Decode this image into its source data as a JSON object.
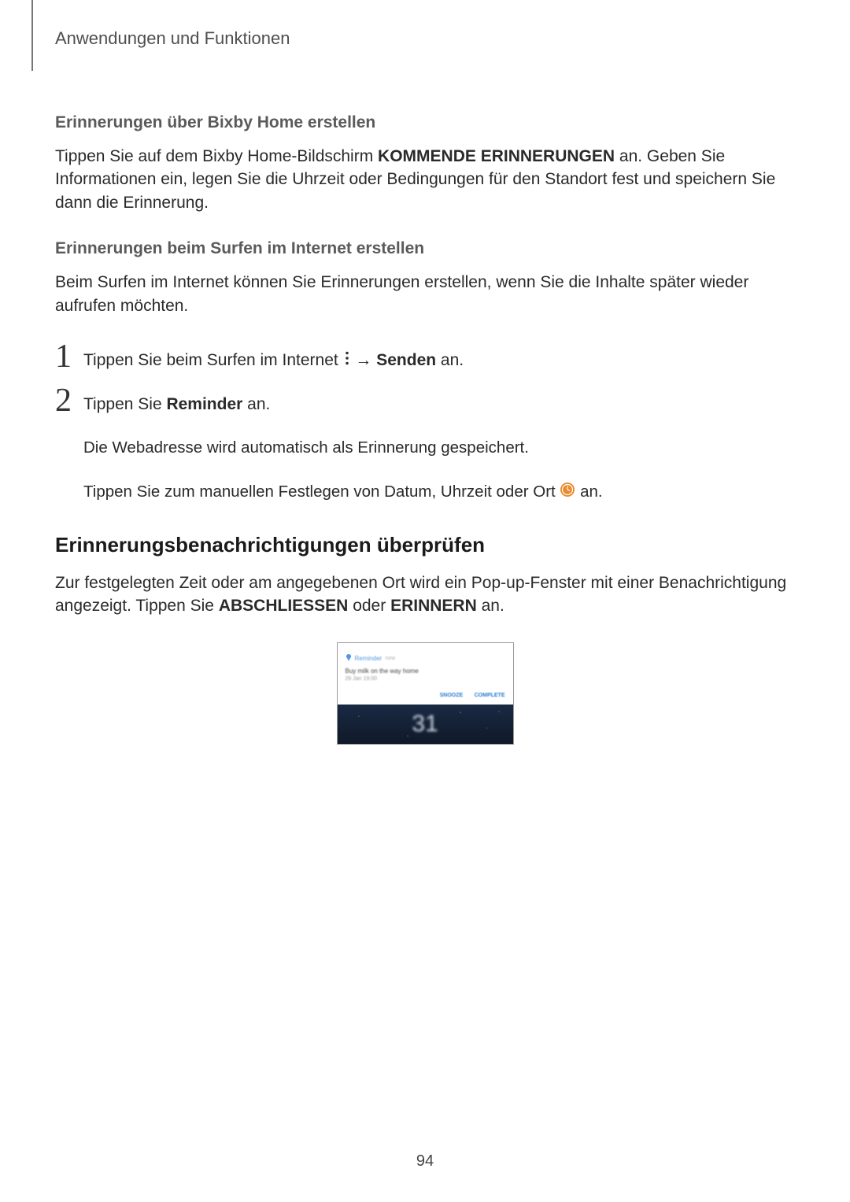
{
  "header": {
    "section": "Anwendungen und Funktionen"
  },
  "s1": {
    "title": "Erinnerungen über Bixby Home erstellen",
    "p_pre": "Tippen Sie auf dem Bixby Home-Bildschirm ",
    "p_bold": "KOMMENDE ERINNERUNGEN",
    "p_post": " an. Geben Sie Informationen ein, legen Sie die Uhrzeit oder Bedingungen für den Standort fest und speichern Sie dann die Erinnerung."
  },
  "s2": {
    "title": "Erinnerungen beim Surfen im Internet erstellen",
    "p": "Beim Surfen im Internet können Sie Erinnerungen erstellen, wenn Sie die Inhalte später wieder aufrufen möchten."
  },
  "step1": {
    "num": "1",
    "pre": "Tippen Sie beim Surfen im Internet ",
    "arrow": " → ",
    "bold": "Senden",
    "post": " an."
  },
  "step2": {
    "num": "2",
    "pre": "Tippen Sie ",
    "bold": "Reminder",
    "post": " an.",
    "sub1": "Die Webadresse wird automatisch als Erinnerung gespeichert.",
    "sub2_pre": "Tippen Sie zum manuellen Festlegen von Datum, Uhrzeit oder Ort ",
    "sub2_post": " an."
  },
  "s3": {
    "title": "Erinnerungsbenachrichtigungen überprüfen",
    "p_pre": "Zur festgelegten Zeit oder am angegebenen Ort wird ein Pop-up-Fenster mit einer Benachrichtigung angezeigt. Tippen Sie ",
    "p_b1": "ABSCHLIESSEN",
    "p_mid": " oder ",
    "p_b2": "ERINNERN",
    "p_post": " an."
  },
  "screenshot": {
    "app": "Reminder",
    "time": "now",
    "title": "Buy milk on the way home",
    "subtitle": "26 Jan 19:00",
    "btn1": "SNOOZE",
    "btn2": "COMPLETE",
    "date": "31"
  },
  "page": {
    "number": "94"
  }
}
